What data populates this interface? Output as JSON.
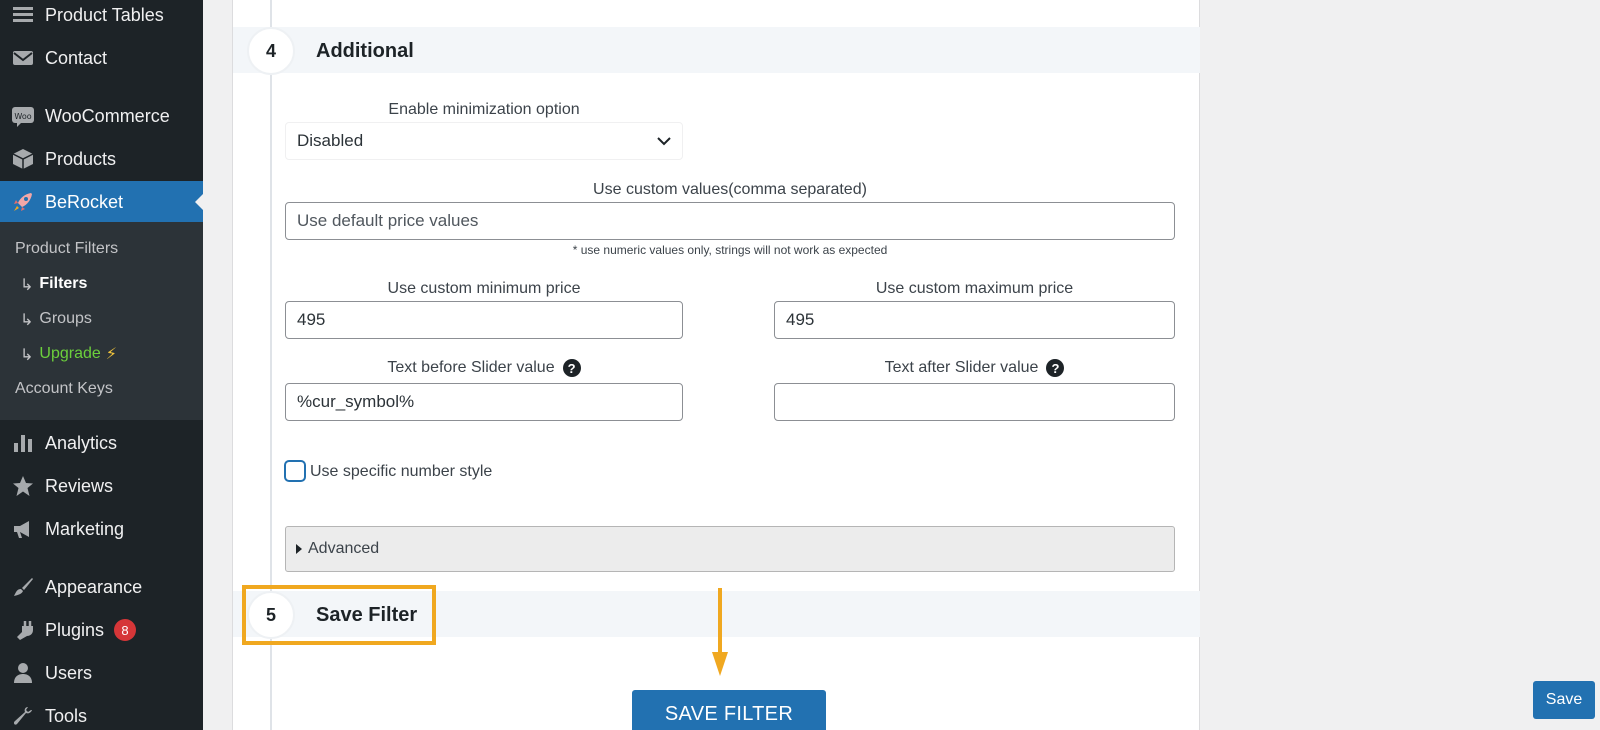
{
  "sidebar": {
    "items": [
      {
        "label": "Product Tables",
        "icon": "list-icon"
      },
      {
        "label": "Contact",
        "icon": "mail-icon"
      },
      {
        "label": "WooCommerce",
        "icon": "woo-icon"
      },
      {
        "label": "Products",
        "icon": "box-icon"
      },
      {
        "label": "BeRocket",
        "icon": "rocket-icon"
      },
      {
        "label": "Analytics",
        "icon": "bar-chart-icon"
      },
      {
        "label": "Reviews",
        "icon": "star-icon"
      },
      {
        "label": "Marketing",
        "icon": "megaphone-icon"
      },
      {
        "label": "Appearance",
        "icon": "brush-icon"
      },
      {
        "label": "Plugins",
        "icon": "plug-icon",
        "badge": "8"
      },
      {
        "label": "Users",
        "icon": "user-icon"
      },
      {
        "label": "Tools",
        "icon": "wrench-icon"
      }
    ],
    "submenu": {
      "title": "Product Filters",
      "filters": "Filters",
      "groups": "Groups",
      "upgrade": "Upgrade",
      "upgrade_icon": "⚡",
      "account_keys": "Account Keys",
      "arrow": "↳"
    }
  },
  "steps": {
    "additional": {
      "number": "4",
      "title": "Additional"
    },
    "save": {
      "number": "5",
      "title": "Save Filter"
    }
  },
  "form": {
    "minimization": {
      "label": "Enable minimization option",
      "value": "Disabled"
    },
    "custom_values": {
      "label": "Use custom values(comma separated)",
      "placeholder": "Use default price values",
      "note": "* use numeric values only, strings will not work as expected"
    },
    "min_price": {
      "label": "Use custom minimum price",
      "value": "495"
    },
    "max_price": {
      "label": "Use custom maximum price",
      "value": "495"
    },
    "text_before": {
      "label": "Text before Slider value",
      "value": "%cur_symbol%",
      "help": "?"
    },
    "text_after": {
      "label": "Text after Slider value",
      "value": "",
      "help": "?"
    },
    "number_style": {
      "label": "Use specific number style",
      "checked": false
    },
    "advanced": {
      "label": "Advanced"
    }
  },
  "buttons": {
    "save_filter": "SAVE FILTER",
    "save": "Save"
  },
  "colors": {
    "sidebar_bg": "#1d2327",
    "accent": "#2271b1",
    "highlight": "#f0a820",
    "upgrade": "#6ccf3c",
    "badge": "#d63638"
  }
}
